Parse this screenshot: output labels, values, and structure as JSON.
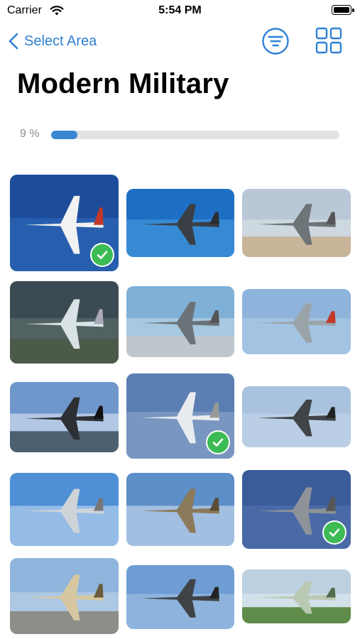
{
  "status": {
    "carrier": "Carrier",
    "time": "5:54 PM"
  },
  "nav": {
    "back_label": "Select Area"
  },
  "page": {
    "title": "Modern Military"
  },
  "progress": {
    "label": "9 %",
    "value_percent": 9
  },
  "theme": {
    "accent": "#2f80d4",
    "progress_fill": "#3a86d1",
    "check": "#3dbb55"
  },
  "grid": {
    "items": [
      {
        "name": "aircraft-1",
        "completed": true
      },
      {
        "name": "aircraft-2",
        "completed": false
      },
      {
        "name": "aircraft-3",
        "completed": false
      },
      {
        "name": "aircraft-4",
        "completed": false
      },
      {
        "name": "aircraft-5",
        "completed": false
      },
      {
        "name": "aircraft-6",
        "completed": false
      },
      {
        "name": "aircraft-7",
        "completed": false
      },
      {
        "name": "aircraft-8",
        "completed": true
      },
      {
        "name": "aircraft-9",
        "completed": false
      },
      {
        "name": "aircraft-10",
        "completed": false
      },
      {
        "name": "aircraft-11",
        "completed": false
      },
      {
        "name": "aircraft-12",
        "completed": true
      },
      {
        "name": "aircraft-13",
        "completed": false
      },
      {
        "name": "aircraft-14",
        "completed": false
      },
      {
        "name": "aircraft-15",
        "completed": false
      }
    ]
  }
}
